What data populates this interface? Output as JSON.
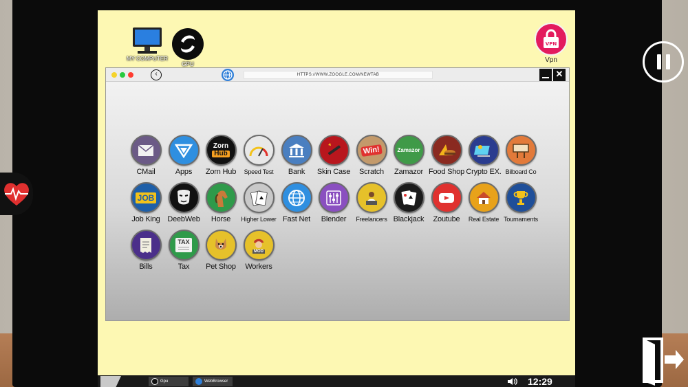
{
  "desktop": {
    "icons": [
      {
        "id": "my-computer",
        "label": "MY COMPUTER"
      },
      {
        "id": "gpu",
        "label": "GPU"
      },
      {
        "id": "vpn",
        "label": "Vpn",
        "badge": "VPN"
      }
    ]
  },
  "browser": {
    "url": "HTTPS://WWW.ZOOGLE.COM/NEWTAB",
    "back_glyph": "‹",
    "close_glyph": "✕"
  },
  "apps": [
    {
      "name": "CMail",
      "icon": "mail-icon",
      "color": "#6b5a86"
    },
    {
      "name": "Apps",
      "icon": "apps-store-icon",
      "color": "#2f8fe0"
    },
    {
      "name": "Zorn Hub",
      "icon": "zornhub-icon",
      "color": "#111111",
      "icon_text_top": "Zorn",
      "icon_text_bottom": "Hub"
    },
    {
      "name": "Speed Test",
      "icon": "speedometer-icon",
      "color": "#e8e8e8"
    },
    {
      "name": "Bank",
      "icon": "bank-icon",
      "color": "#4a7fc0"
    },
    {
      "name": "Skin Case",
      "icon": "skin-case-icon",
      "color": "#b8161d"
    },
    {
      "name": "Scratch",
      "icon": "scratch-win-icon",
      "color": "#c39a6b",
      "icon_text": "Win!"
    },
    {
      "name": "Zamazor",
      "icon": "zamazor-icon",
      "color": "#3f9a48",
      "icon_text": "Zamazor"
    },
    {
      "name": "Food Shop",
      "icon": "food-shop-icon",
      "color": "#8a2a20"
    },
    {
      "name": "Crypto EX.",
      "icon": "crypto-exchange-icon",
      "color": "#2a3c8f"
    },
    {
      "name": "Bilboard Co",
      "icon": "billboard-icon",
      "color": "#e27a3a"
    },
    {
      "name": "Job King",
      "icon": "job-king-icon",
      "color": "#1e5fa8",
      "icon_text": "JOB"
    },
    {
      "name": "DeebWeb",
      "icon": "mask-icon",
      "color": "#111111"
    },
    {
      "name": "Horse",
      "icon": "horse-icon",
      "color": "#2f9a4a"
    },
    {
      "name": "Higher Lower",
      "icon": "cards-icon",
      "color": "#c9c9c9"
    },
    {
      "name": "Fast Net",
      "icon": "fast-net-icon",
      "color": "#2f8fe0"
    },
    {
      "name": "Blender",
      "icon": "blender-icon",
      "color": "#8a4fc0"
    },
    {
      "name": "Freelancers",
      "icon": "freelancers-icon",
      "color": "#e6c12a"
    },
    {
      "name": "Blackjack",
      "icon": "blackjack-icon",
      "color": "#1a1a1a"
    },
    {
      "name": "Zoutube",
      "icon": "zoutube-icon",
      "color": "#e0312f"
    },
    {
      "name": "Real Estate",
      "icon": "real-estate-icon",
      "color": "#e8a21a"
    },
    {
      "name": "Tournaments",
      "icon": "trophy-icon",
      "color": "#1f4f99"
    },
    {
      "name": "Bills",
      "icon": "bills-icon",
      "color": "#4b2f8a"
    },
    {
      "name": "Tax",
      "icon": "tax-icon",
      "color": "#2f9a4a",
      "icon_text": "TAX"
    },
    {
      "name": "Pet Shop",
      "icon": "pet-shop-icon",
      "color": "#e6c12a"
    },
    {
      "name": "Workers",
      "icon": "workers-icon",
      "color": "#e6c12a",
      "icon_text": "MOD"
    }
  ],
  "taskbar": {
    "items": [
      {
        "label": "Gpu"
      },
      {
        "label": "WebBrowser"
      }
    ],
    "clock": "12:29"
  }
}
